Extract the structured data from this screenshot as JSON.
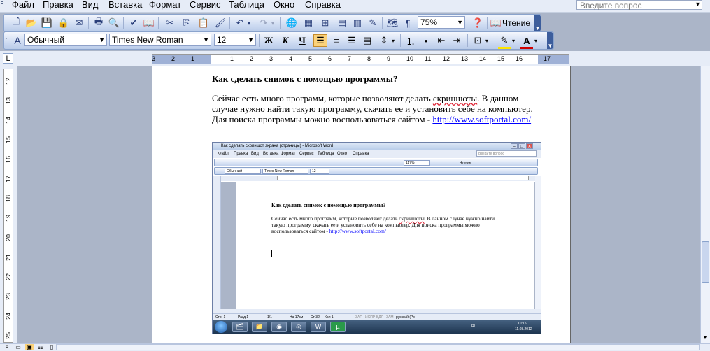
{
  "menubar": {
    "items": [
      "Файл",
      "Правка",
      "Вид",
      "Вставка",
      "Формат",
      "Сервис",
      "Таблица",
      "Окно",
      "Справка"
    ],
    "help_placeholder": "Введите вопрос"
  },
  "toolbar_standard": {
    "zoom": "75%",
    "reading_label": "Чтение"
  },
  "toolbar_format": {
    "style": "Обычный",
    "font": "Times New Roman",
    "size": "12",
    "bold": "Ж",
    "italic": "К",
    "underline": "Ч"
  },
  "ruler": {
    "corner": "L",
    "hnums": [
      "3",
      "2",
      "1",
      "1",
      "2",
      "3",
      "4",
      "5",
      "6",
      "7",
      "8",
      "9",
      "10",
      "11",
      "12",
      "13",
      "14",
      "15",
      "16",
      "17"
    ],
    "vnums": [
      "12",
      "13",
      "14",
      "15",
      "16",
      "17",
      "18",
      "19",
      "20",
      "21",
      "22",
      "23",
      "24",
      "25"
    ]
  },
  "document": {
    "heading": "Как сделать снимок с помощью программы?",
    "para_before_spell": "Сейчас есть много программ, которые позволяют делать ",
    "spell_word": "скриншоты",
    "para_after_spell": ". В данном случае нужно найти такую программу, скачать ее и установить себе на компьютер. Для поиска программы можно воспользоваться сайтом - ",
    "link": "http://www.softportal.com/"
  },
  "screenshot": {
    "title": "Как сделать скриншот экрана (страницы) - Microsoft Word",
    "menu_items": [
      "Файл",
      "Правка",
      "Вид",
      "Вставка",
      "Формат",
      "Сервис",
      "Таблица",
      "Окно",
      "Справка"
    ],
    "help_placeholder": "Введите вопрос",
    "zoom": "117%",
    "reading_label": "Чтение",
    "style": "Обычный",
    "font": "Times New Roman",
    "size": "12",
    "heading": "Как сделать снимок с помощью программы?",
    "para_before_spell": "Сейчас есть много программ, которые позволяют делать ",
    "spell_word": "скриншоты",
    "para_after_spell": ". В данном случае нужно найти такую программу, скачать ее и установить себе на компьютер. Для поиска программы можно воспользоваться сайтом - ",
    "link": "http://www.softportal.com/",
    "status": [
      "Стр. 1",
      "Разд 1",
      "1/1",
      "На 17см",
      "Ст 32",
      "Кол 1",
      "ЗАП",
      "ИСПР",
      "ВДЛ",
      "ЗАМ",
      "русский (Ро"
    ],
    "tray_lang": "RU",
    "tray_time": "10:15",
    "tray_date": "11.08.2012"
  },
  "colors": {
    "link": "#0000ff",
    "toolbar_accent": "#3c5d9c",
    "active_button": "#fbd27a"
  }
}
